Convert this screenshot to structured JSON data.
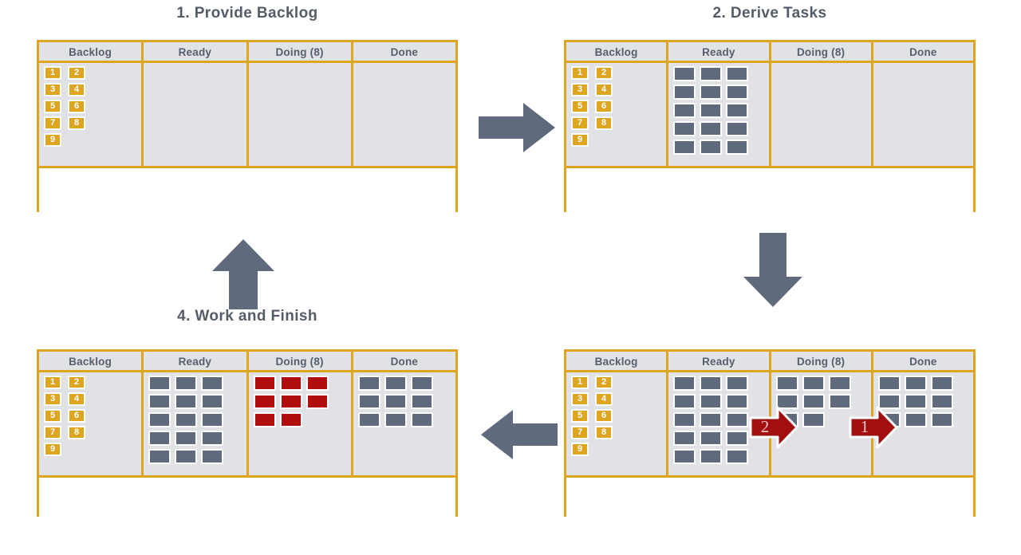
{
  "diagram": {
    "title_color": "#545c68",
    "accent_color": "#dda520",
    "tile_color": "#5f6b7d",
    "tile_active_color": "#b00d0d",
    "board_bg": "#e0e2e5"
  },
  "columns": {
    "backlog": "Backlog",
    "ready": "Ready",
    "doing": "Doing (8)",
    "done": "Done"
  },
  "backlog_cards": [
    "1",
    "2",
    "3",
    "4",
    "5",
    "6",
    "7",
    "8",
    "9"
  ],
  "panels": [
    {
      "id": "provide-backlog",
      "title": "1. Provide Backlog",
      "columns": [
        {
          "name": "backlog",
          "header": "Backlog",
          "kind": "cards",
          "cards": [
            "1",
            "2",
            "3",
            "4",
            "5",
            "6",
            "7",
            "8",
            "9"
          ]
        },
        {
          "name": "ready",
          "header": "Ready",
          "kind": "tiles",
          "tiles": 0,
          "tile_state": "idle"
        },
        {
          "name": "doing",
          "header": "Doing (8)",
          "kind": "tiles",
          "tiles": 0,
          "tile_state": "idle"
        },
        {
          "name": "done",
          "header": "Done",
          "kind": "tiles",
          "tiles": 0,
          "tile_state": "idle"
        }
      ]
    },
    {
      "id": "derive-tasks",
      "title": "2. Derive Tasks",
      "columns": [
        {
          "name": "backlog",
          "header": "Backlog",
          "kind": "cards",
          "cards": [
            "1",
            "2",
            "3",
            "4",
            "5",
            "6",
            "7",
            "8",
            "9"
          ]
        },
        {
          "name": "ready",
          "header": "Ready",
          "kind": "tiles",
          "tiles": 15,
          "tile_state": "idle"
        },
        {
          "name": "doing",
          "header": "Doing (8)",
          "kind": "tiles",
          "tiles": 0,
          "tile_state": "idle"
        },
        {
          "name": "done",
          "header": "Done",
          "kind": "tiles",
          "tiles": 0,
          "tile_state": "idle"
        }
      ]
    },
    {
      "id": "pull-tasks",
      "title": "",
      "columns": [
        {
          "name": "backlog",
          "header": "Backlog",
          "kind": "cards",
          "cards": [
            "1",
            "2",
            "3",
            "4",
            "5",
            "6",
            "7",
            "8",
            "9"
          ]
        },
        {
          "name": "ready",
          "header": "Ready",
          "kind": "tiles",
          "tiles": 15,
          "tile_state": "idle"
        },
        {
          "name": "doing",
          "header": "Doing (8)",
          "kind": "tiles",
          "tiles": 8,
          "tile_state": "idle"
        },
        {
          "name": "done",
          "header": "Done",
          "kind": "tiles",
          "tiles": 9,
          "tile_state": "idle"
        }
      ],
      "pull_arrows": [
        {
          "label": "2",
          "from": "ready",
          "to": "doing"
        },
        {
          "label": "1",
          "from": "doing",
          "to": "done"
        }
      ]
    },
    {
      "id": "work-and-finish",
      "title": "4. Work and Finish",
      "columns": [
        {
          "name": "backlog",
          "header": "Backlog",
          "kind": "cards",
          "cards": [
            "1",
            "2",
            "3",
            "4",
            "5",
            "6",
            "7",
            "8",
            "9"
          ]
        },
        {
          "name": "ready",
          "header": "Ready",
          "kind": "tiles",
          "tiles": 15,
          "tile_state": "idle"
        },
        {
          "name": "doing",
          "header": "Doing (8)",
          "kind": "tiles",
          "tiles": 8,
          "tile_state": "active"
        },
        {
          "name": "done",
          "header": "Done",
          "kind": "tiles",
          "tiles": 9,
          "tile_state": "idle"
        }
      ]
    }
  ],
  "flow_arrows": [
    {
      "name": "arrow-step1-to-step2",
      "direction": "right"
    },
    {
      "name": "arrow-step2-to-step3",
      "direction": "down"
    },
    {
      "name": "arrow-step3-to-step4",
      "direction": "left"
    },
    {
      "name": "arrow-step4-to-step1",
      "direction": "up"
    }
  ]
}
